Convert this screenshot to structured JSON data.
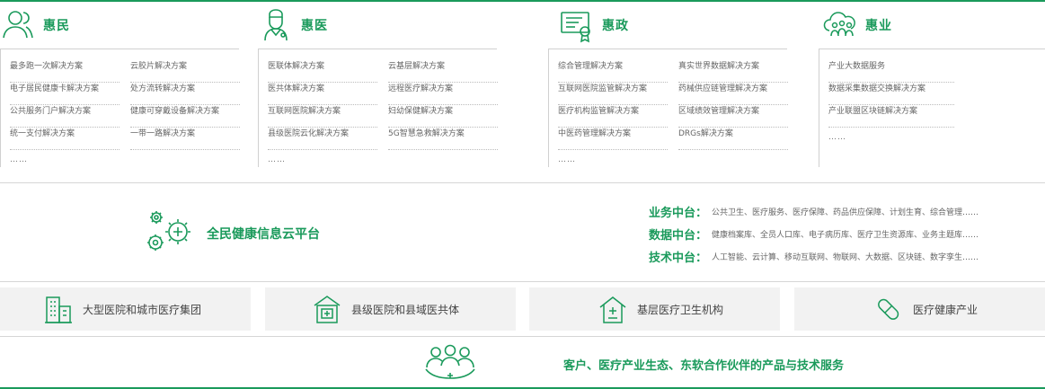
{
  "categories": [
    {
      "title": "惠民",
      "icon": "people-icon",
      "col1": [
        "最多跑一次解决方案",
        "电子居民健康卡解决方案",
        "公共服务门户解决方案",
        "统一支付解决方案"
      ],
      "col2": [
        "云胶片解决方案",
        "处方流转解决方案",
        "健康可穿戴设备解决方案",
        "一带一路解决方案"
      ],
      "more": "……"
    },
    {
      "title": "惠医",
      "icon": "doctor-icon",
      "col1": [
        "医联体解决方案",
        "医共体解决方案",
        "互联网医院解决方案",
        "县级医院云化解决方案"
      ],
      "col2": [
        "云基层解决方案",
        "远程医疗解决方案",
        "妇幼保健解决方案",
        "5G智慧急救解决方案"
      ],
      "more": "……"
    },
    {
      "title": "惠政",
      "icon": "certificate-icon",
      "col1": [
        "综合管理解决方案",
        "互联网医院监管解决方案",
        "医疗机构监管解决方案",
        "中医药管理解决方案"
      ],
      "col2": [
        "真实世界数据解决方案",
        "药械供应链管理解决方案",
        "区域绩效管理解决方案",
        "DRGs解决方案"
      ],
      "more": "……"
    },
    {
      "title": "惠业",
      "icon": "cloud-people-icon",
      "col1": [
        "产业大数据服务",
        "数据采集数据交换解决方案",
        "产业联盟区块链解决方案"
      ],
      "col2": [],
      "more": "……"
    }
  ],
  "platform": {
    "title": "全民健康信息云平台",
    "rows": [
      {
        "label": "业务中台：",
        "text": "公共卫生、医疗服务、医疗保障、药品供应保障、计划生育、综合管理……"
      },
      {
        "label": "数据中台：",
        "text": "健康档案库、全员人口库、电子病历库、医疗卫生资源库、业务主题库……"
      },
      {
        "label": "技术中台：",
        "text": "人工智能、云计算、移动互联网、物联网、大数据、区块链、数字孪生……"
      }
    ]
  },
  "institutions": [
    {
      "label": "大型医院和城市医疗集团",
      "icon": "building-icon"
    },
    {
      "label": "县级医院和县域医共体",
      "icon": "hospital-icon"
    },
    {
      "label": "基层医疗卫生机构",
      "icon": "clinic-house-icon"
    },
    {
      "label": "医疗健康产业",
      "icon": "pill-icon"
    }
  ],
  "bottom": {
    "label": "客户、医疗产业生态、东软合作伙伴的产品与技术服务"
  },
  "colors": {
    "accent": "#1a9a5b",
    "panel_bg": "#f2f2f2",
    "text": "#666666"
  }
}
